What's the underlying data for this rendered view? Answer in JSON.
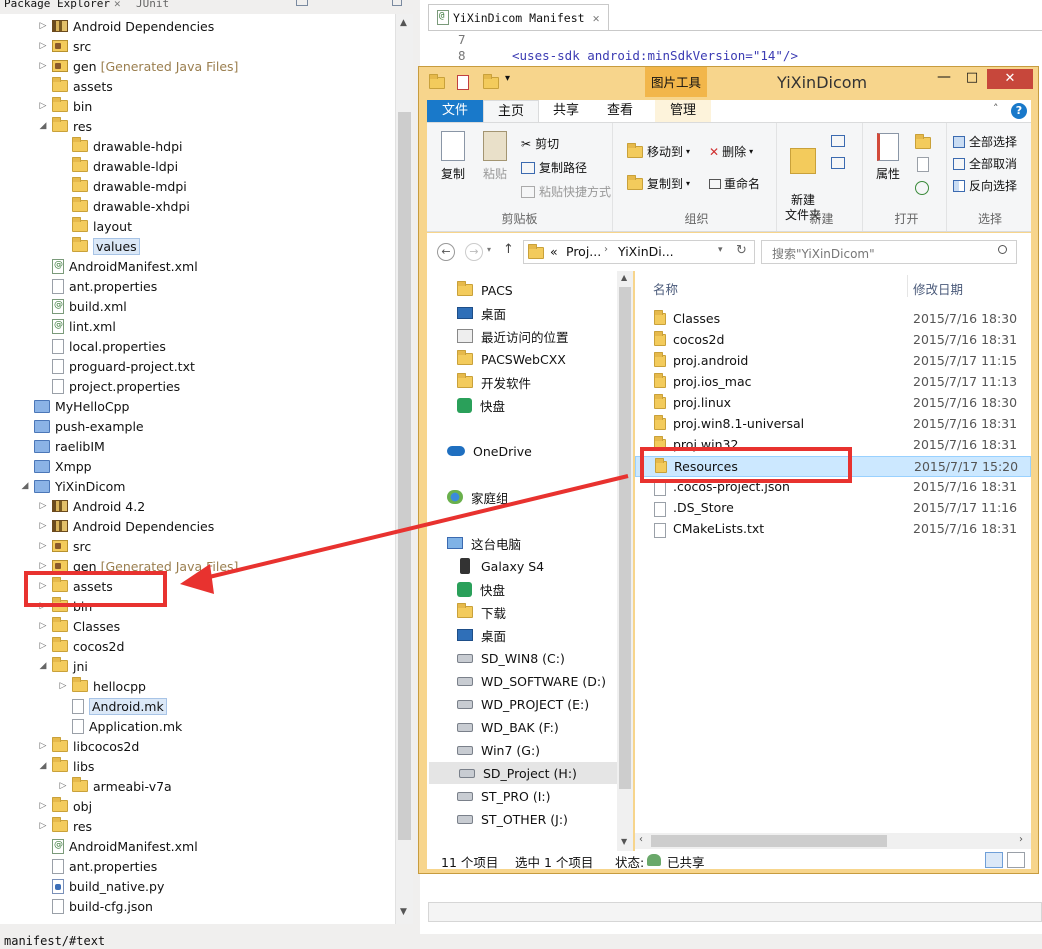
{
  "left_pane": {
    "tabs": [
      "Package Explorer",
      "JUnit"
    ],
    "tree": [
      {
        "label": "Android Dependencies",
        "icon": "library",
        "arrow": "right"
      },
      {
        "label": "src",
        "icon": "package",
        "arrow": "right"
      },
      {
        "label": "gen",
        "suffix": "[Generated Java Files]",
        "icon": "package",
        "arrow": "right"
      },
      {
        "label": "assets",
        "icon": "folder",
        "arrow": ""
      },
      {
        "label": "bin",
        "icon": "folder",
        "arrow": "right"
      },
      {
        "label": "res",
        "icon": "folder",
        "arrow": "down"
      },
      {
        "label": "drawable-hdpi",
        "icon": "folder",
        "arrow": ""
      },
      {
        "label": "drawable-ldpi",
        "icon": "folder",
        "arrow": ""
      },
      {
        "label": "drawable-mdpi",
        "icon": "folder",
        "arrow": ""
      },
      {
        "label": "drawable-xhdpi",
        "icon": "folder",
        "arrow": ""
      },
      {
        "label": "layout",
        "icon": "folder",
        "arrow": ""
      },
      {
        "label": "values",
        "icon": "folder",
        "arrow": "",
        "selected": true
      },
      {
        "label": "AndroidManifest.xml",
        "icon": "xml",
        "arrow": ""
      },
      {
        "label": "ant.properties",
        "icon": "file",
        "arrow": ""
      },
      {
        "label": "build.xml",
        "icon": "xml",
        "arrow": ""
      },
      {
        "label": "lint.xml",
        "icon": "xml",
        "arrow": ""
      },
      {
        "label": "local.properties",
        "icon": "file",
        "arrow": ""
      },
      {
        "label": "proguard-project.txt",
        "icon": "file",
        "arrow": ""
      },
      {
        "label": "project.properties",
        "icon": "file",
        "arrow": ""
      },
      {
        "label": "MyHelloCpp",
        "icon": "project",
        "arrow": ""
      },
      {
        "label": "push-example",
        "icon": "project",
        "arrow": ""
      },
      {
        "label": "raelibIM",
        "icon": "project",
        "arrow": ""
      },
      {
        "label": "Xmpp",
        "icon": "project",
        "arrow": ""
      },
      {
        "label": "YiXinDicom",
        "icon": "project",
        "arrow": "down"
      },
      {
        "label": "Android 4.2",
        "icon": "library",
        "arrow": "right"
      },
      {
        "label": "Android Dependencies",
        "icon": "library",
        "arrow": "right"
      },
      {
        "label": "src",
        "icon": "package",
        "arrow": "right"
      },
      {
        "label": "gen",
        "suffix": "[Generated Java Files]",
        "icon": "package",
        "arrow": "right"
      },
      {
        "label": "assets",
        "icon": "folder",
        "arrow": "right"
      },
      {
        "label": "bin",
        "icon": "folder",
        "arrow": "right"
      },
      {
        "label": "Classes",
        "icon": "folder",
        "arrow": "right"
      },
      {
        "label": "cocos2d",
        "icon": "folder",
        "arrow": "right"
      },
      {
        "label": "jni",
        "icon": "folder",
        "arrow": "down"
      },
      {
        "label": "hellocpp",
        "icon": "folder",
        "arrow": "right"
      },
      {
        "label": "Android.mk",
        "icon": "file",
        "arrow": "",
        "selected": true
      },
      {
        "label": "Application.mk",
        "icon": "file",
        "arrow": ""
      },
      {
        "label": "libcocos2d",
        "icon": "folder",
        "arrow": "right"
      },
      {
        "label": "libs",
        "icon": "folder",
        "arrow": "down"
      },
      {
        "label": "armeabi-v7a",
        "icon": "folder",
        "arrow": "right"
      },
      {
        "label": "obj",
        "icon": "folder",
        "arrow": "right"
      },
      {
        "label": "res",
        "icon": "folder",
        "arrow": "right"
      },
      {
        "label": "AndroidManifest.xml",
        "icon": "xml",
        "arrow": ""
      },
      {
        "label": "ant.properties",
        "icon": "file",
        "arrow": ""
      },
      {
        "label": "build_native.py",
        "icon": "python",
        "arrow": ""
      },
      {
        "label": "build-cfg.json",
        "icon": "file",
        "arrow": ""
      }
    ]
  },
  "statusbar": {
    "text": "manifest/#text"
  },
  "editor": {
    "tab": "YiXinDicom Manifest",
    "lines": [
      {
        "no": "7",
        "text": ""
      },
      {
        "no": "8",
        "text": "<uses-sdk android:minSdkVersion=\"14\"/>"
      }
    ]
  },
  "explorer": {
    "title": "YiXinDicom",
    "contextual_tab": "图片工具",
    "tabs": [
      "文件",
      "主页",
      "共享",
      "查看",
      "管理"
    ],
    "ribbon": {
      "clipboard": {
        "label": "剪贴板",
        "copy": "复制",
        "paste": "粘贴",
        "cut": "剪切",
        "copy_path": "复制路径",
        "paste_shortcut": "粘贴快捷方式"
      },
      "organize": {
        "label": "组织",
        "move_to": "移动到",
        "copy_to": "复制到",
        "delete": "删除",
        "rename": "重命名"
      },
      "new": {
        "label": "新建",
        "new_folder": "新建\n文件夹"
      },
      "open": {
        "label": "打开",
        "properties": "属性"
      },
      "select": {
        "label": "选择",
        "select_all": "全部选择",
        "select_none": "全部取消",
        "invert": "反向选择"
      }
    },
    "address": [
      "«",
      "Proj...",
      "YiXinDi..."
    ],
    "search_placeholder": "搜索\"YiXinDicom\"",
    "nav": [
      {
        "label": "PACS",
        "icon": "folder"
      },
      {
        "label": "桌面",
        "icon": "desktop"
      },
      {
        "label": "最近访问的位置",
        "icon": "recent"
      },
      {
        "label": "PACSWebCXX",
        "icon": "folder"
      },
      {
        "label": "开发软件",
        "icon": "folder"
      },
      {
        "label": "快盘",
        "icon": "kuaipan"
      },
      {
        "label": "OneDrive",
        "icon": "cloud"
      },
      {
        "label": "家庭组",
        "icon": "homegroup"
      },
      {
        "label": "这台电脑",
        "icon": "pc"
      },
      {
        "label": "Galaxy S4",
        "icon": "phone"
      },
      {
        "label": "快盘",
        "icon": "kuaipan"
      },
      {
        "label": "下载",
        "icon": "download"
      },
      {
        "label": "桌面",
        "icon": "desktop"
      },
      {
        "label": "SD_WIN8 (C:)",
        "icon": "drive"
      },
      {
        "label": "WD_SOFTWARE (D:)",
        "icon": "drive"
      },
      {
        "label": "WD_PROJECT (E:)",
        "icon": "drive"
      },
      {
        "label": "WD_BAK (F:)",
        "icon": "drive"
      },
      {
        "label": "Win7 (G:)",
        "icon": "drive"
      },
      {
        "label": "SD_Project (H:)",
        "icon": "drive",
        "selected": true
      },
      {
        "label": "ST_PRO (I:)",
        "icon": "drive"
      },
      {
        "label": "ST_OTHER (J:)",
        "icon": "drive"
      }
    ],
    "columns": {
      "name": "名称",
      "date": "修改日期"
    },
    "files": [
      {
        "name": "Classes",
        "date": "2015/7/16 18:30",
        "icon": "folder"
      },
      {
        "name": "cocos2d",
        "date": "2015/7/16 18:31",
        "icon": "folder"
      },
      {
        "name": "proj.android",
        "date": "2015/7/17 11:15",
        "icon": "folder"
      },
      {
        "name": "proj.ios_mac",
        "date": "2015/7/17 11:13",
        "icon": "folder"
      },
      {
        "name": "proj.linux",
        "date": "2015/7/16 18:30",
        "icon": "folder"
      },
      {
        "name": "proj.win8.1-universal",
        "date": "2015/7/16 18:31",
        "icon": "folder"
      },
      {
        "name": "proj.win32",
        "date": "2015/7/16 18:31",
        "icon": "folder"
      },
      {
        "name": "Resources",
        "date": "2015/7/17 15:20",
        "icon": "folder",
        "selected": true
      },
      {
        "name": ".cocos-project.json",
        "date": "2015/7/16 18:31",
        "icon": "file"
      },
      {
        "name": ".DS_Store",
        "date": "2015/7/17 11:16",
        "icon": "file"
      },
      {
        "name": "CMakeLists.txt",
        "date": "2015/7/16 18:31",
        "icon": "file"
      }
    ],
    "status": {
      "count": "11 个项目",
      "selected": "选中 1 个项目",
      "state": "状态:",
      "shared": "已共享"
    }
  },
  "annotation_color": "#e8322f"
}
